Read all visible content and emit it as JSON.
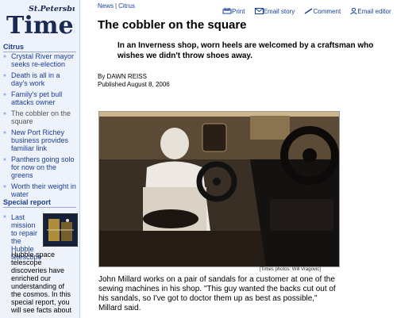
{
  "masthead": {
    "logo_small": "St.Petersburg",
    "logo_big": "Times"
  },
  "sidebar": {
    "citrus_heading": "Citrus",
    "items": [
      {
        "label": "Crystal River mayor seeks re-election"
      },
      {
        "label": "Death is all in a day's work"
      },
      {
        "label": "Family's pet bull attacks owner"
      },
      {
        "label": "The cobbler on the square"
      },
      {
        "label": "New Port Richey business provides familiar link"
      },
      {
        "label": "Panthers going solo for now on the greens"
      },
      {
        "label": "Worth their weight in water"
      }
    ],
    "special": {
      "heading": "Special report",
      "link": "Last mission to repair the Hubble telescope",
      "text": "Hubble space telescope discoveries have enriched our understanding of the cosmos. In this special report, you will see facts about"
    }
  },
  "breadcrumb": {
    "item1": "News",
    "sep": "|",
    "item2": "Citrus"
  },
  "tools": {
    "print": "Print",
    "email_story": "Email story",
    "comment": "Comment",
    "email_editor": "Email editor"
  },
  "article": {
    "title": "The cobbler on the square",
    "dek": "In an Inverness shop, worn heels are welcomed by a craftsman who wishes we didn't throw shoes away.",
    "byline": "By DAWN REISS",
    "published": "Published August 8, 2006",
    "photo_credit": "[Times photos: Will Vragovic]",
    "caption": "John Millard works on a pair of sandals for a customer at one of the sewing machines in his shop. \"This guy wanted the backs cut out of his sandals, so I've got to doctor them up as best as possible,\" Millard said."
  }
}
